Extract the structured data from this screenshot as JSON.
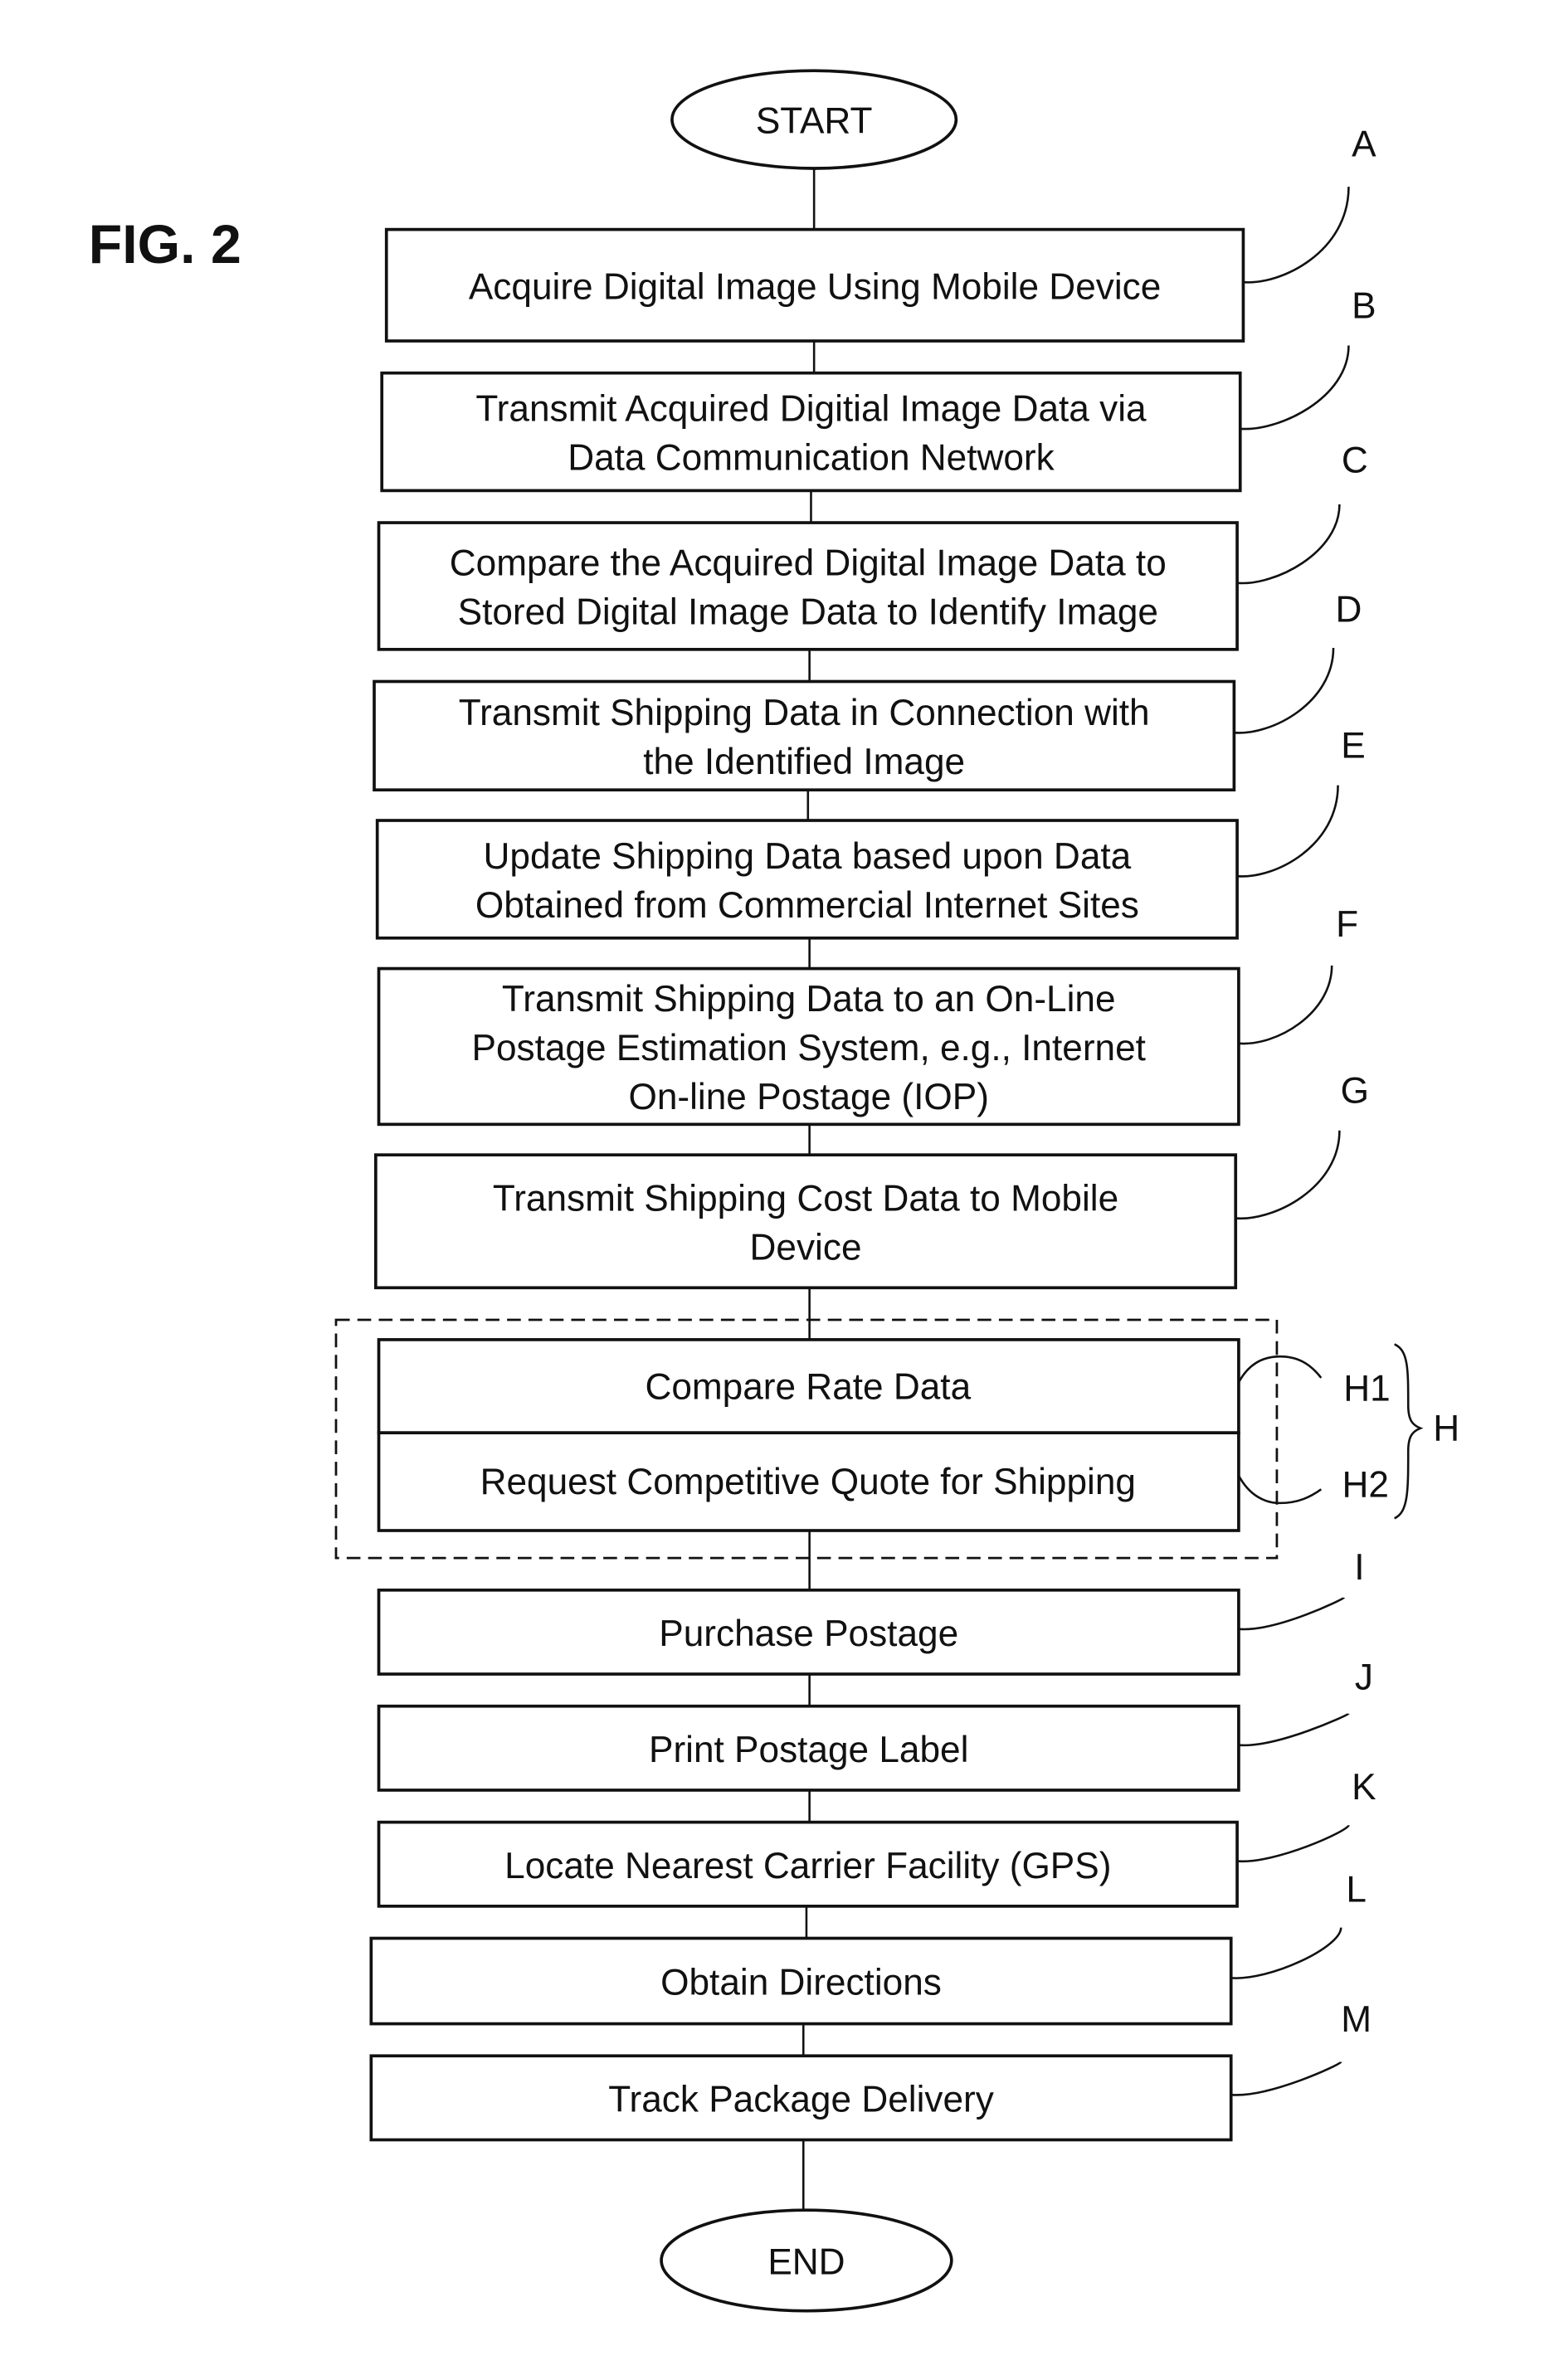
{
  "figure_label": "FIG. 2",
  "terminals": {
    "start": "START",
    "end": "END"
  },
  "steps": [
    {
      "ref": "A",
      "lines": [
        "Acquire Digital Image Using Mobile Device"
      ]
    },
    {
      "ref": "B",
      "lines": [
        "Transmit Acquired Digitial Image Data via",
        "Data Communication Network"
      ]
    },
    {
      "ref": "C",
      "lines": [
        "Compare the Acquired Digital Image Data to",
        "Stored Digital Image Data to Identify Image"
      ]
    },
    {
      "ref": "D",
      "lines": [
        "Transmit Shipping Data in Connection with",
        "the Identified Image"
      ]
    },
    {
      "ref": "E",
      "lines": [
        "Update Shipping Data based upon Data",
        "Obtained from Commercial Internet Sites"
      ]
    },
    {
      "ref": "F",
      "lines": [
        "Transmit Shipping Data to an On-Line",
        "Postage Estimation System, e.g., Internet",
        "On-line Postage (IOP)"
      ]
    },
    {
      "ref": "G",
      "lines": [
        "Transmit Shipping Cost Data to Mobile",
        "Device"
      ]
    }
  ],
  "group_h": {
    "ref": "H",
    "substeps": [
      {
        "ref": "H1",
        "label": "Compare Rate Data"
      },
      {
        "ref": "H2",
        "label": "Request Competitive Quote for Shipping"
      }
    ]
  },
  "steps_after": [
    {
      "ref": "I",
      "lines": [
        "Purchase Postage"
      ]
    },
    {
      "ref": "J",
      "lines": [
        "Print Postage Label"
      ]
    },
    {
      "ref": "K",
      "lines": [
        "Locate Nearest Carrier Facility (GPS)"
      ]
    },
    {
      "ref": "L",
      "lines": [
        "Obtain Directions"
      ]
    },
    {
      "ref": "M",
      "lines": [
        "Track Package Delivery"
      ]
    }
  ]
}
